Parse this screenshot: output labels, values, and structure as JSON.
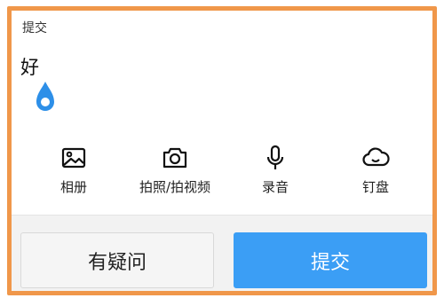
{
  "header": {
    "title": "提交"
  },
  "editor": {
    "content": "好"
  },
  "toolbar": {
    "items": [
      {
        "label": "相册",
        "icon": "image-icon"
      },
      {
        "label": "拍照/拍视频",
        "icon": "camera-icon"
      },
      {
        "label": "录音",
        "icon": "microphone-icon"
      },
      {
        "label": "钉盘",
        "icon": "cloud-icon"
      }
    ]
  },
  "actions": {
    "question_label": "有疑问",
    "submit_label": "提交"
  },
  "colors": {
    "frame": "#f0974a",
    "submit_bg": "#3b9ef5",
    "cursor_handle": "#2d8fe8"
  }
}
